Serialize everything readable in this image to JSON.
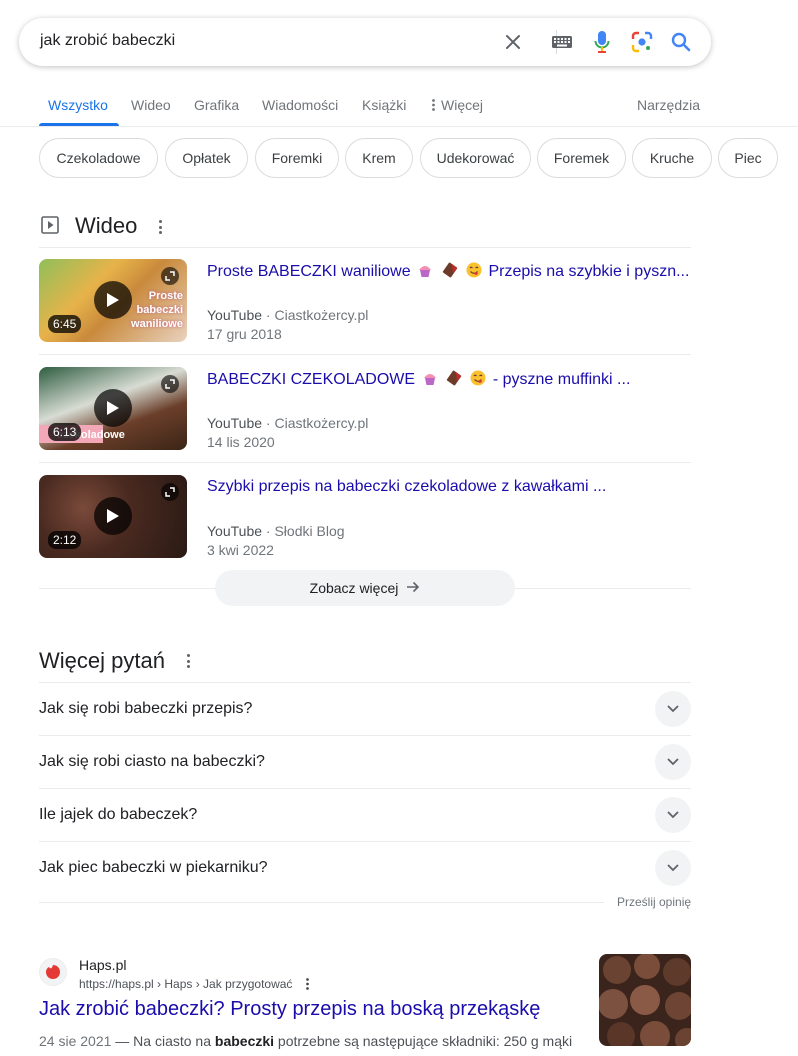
{
  "search": {
    "query": "jak zrobić babeczki"
  },
  "tabs": {
    "items": [
      {
        "label": "Wszystko",
        "active": true
      },
      {
        "label": "Wideo"
      },
      {
        "label": "Grafika"
      },
      {
        "label": "Wiadomości"
      },
      {
        "label": "Książki"
      },
      {
        "label": "Więcej"
      }
    ],
    "tools": "Narzędzia"
  },
  "chips": [
    "Czekoladowe",
    "Opłatek",
    "Foremki",
    "Krem",
    "Udekorować",
    "Foremek",
    "Kruche",
    "Piec"
  ],
  "videos": {
    "heading": "Wideo",
    "items": [
      {
        "title_a": "Proste BABECZKI waniliowe",
        "title_b": "Przepis na szybkie i pyszn...",
        "platform": "YouTube",
        "channel": "Ciastkożercy.pl",
        "date": "17 gru 2018",
        "duration": "6:45",
        "overlay_text": "Proste babeczki waniliowe"
      },
      {
        "title_a": "BABECZKI CZEKOLADOWE",
        "title_b": "- pyszne muffinki ...",
        "platform": "YouTube",
        "channel": "Ciastkożercy.pl",
        "date": "14 lis 2020",
        "duration": "6:13",
        "overlay_text": "czekoladowe"
      },
      {
        "title_a": "Szybki przepis na babeczki czekoladowe z kawałkami ...",
        "title_b": "",
        "platform": "YouTube",
        "channel": "Słodki Blog",
        "date": "3 kwi 2022",
        "duration": "2:12"
      }
    ],
    "see_more": "Zobacz więcej"
  },
  "questions": {
    "heading": "Więcej pytań",
    "items": [
      "Jak się robi babeczki przepis?",
      "Jak się robi ciasto na babeczki?",
      "Ile jajek do babeczek?",
      "Jak piec babeczki w piekarniku?"
    ],
    "feedback": "Prześlij opinię"
  },
  "result": {
    "site_name": "Haps.pl",
    "url": "https://haps.pl › Haps › Jak przygotować",
    "title": "Jak zrobić babeczki? Prosty przepis na boską przekąskę",
    "date": "24 sie 2021",
    "snippet_pre": " — Na ciasto na ",
    "snippet_bold": "babeczki",
    "snippet_post": " potrzebne są następujące składniki: 250 g mąki"
  },
  "colors": {
    "link": "#1a0dab",
    "accent": "#1a73e8",
    "muted": "#70757a"
  }
}
